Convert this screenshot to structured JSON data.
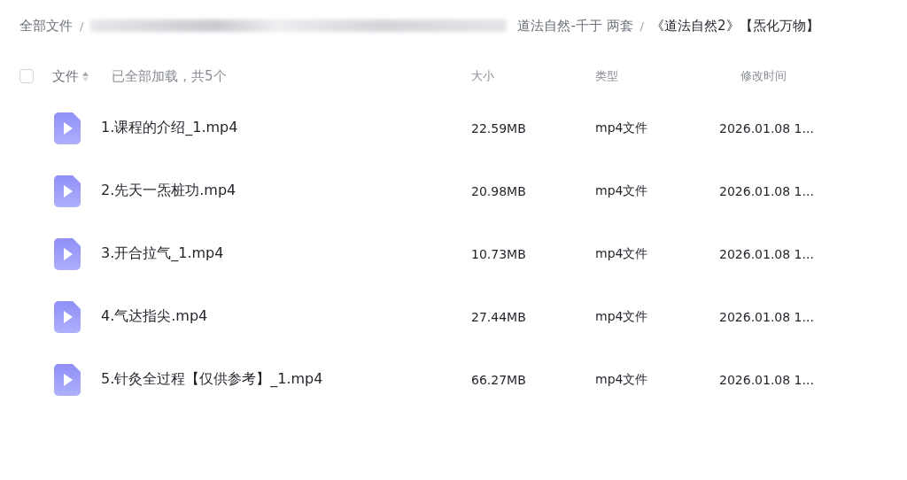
{
  "breadcrumb_separator": "/",
  "breadcrumb": [
    {
      "label": "全部文件",
      "current": false
    },
    {
      "label": "道法自然-千于 两套",
      "current": false
    },
    {
      "label": "《道法自然2》【炁化万物】",
      "current": true
    }
  ],
  "header": {
    "select_all": {
      "checked": false
    },
    "name_column": "文件",
    "load_status": "已全部加载，共5个",
    "columns": [
      "大小",
      "类型",
      "修改时间"
    ]
  },
  "files": [
    {
      "name": "1.课程的介绍_1.mp4",
      "size": "22.59MB",
      "type": "mp4文件",
      "modified": "2026.01.08 1..."
    },
    {
      "name": "2.先天一炁桩功.mp4",
      "size": "20.98MB",
      "type": "mp4文件",
      "modified": "2026.01.08 1..."
    },
    {
      "name": "3.开合拉气_1.mp4",
      "size": "10.73MB",
      "type": "mp4文件",
      "modified": "2026.01.08 1..."
    },
    {
      "name": "4.气达指尖.mp4",
      "size": "27.44MB",
      "type": "mp4文件",
      "modified": "2026.01.08 1..."
    },
    {
      "name": "5.针灸全过程【仅供参考】_1.mp4",
      "size": "66.27MB",
      "type": "mp4文件",
      "modified": "2026.01.08 1..."
    }
  ]
}
